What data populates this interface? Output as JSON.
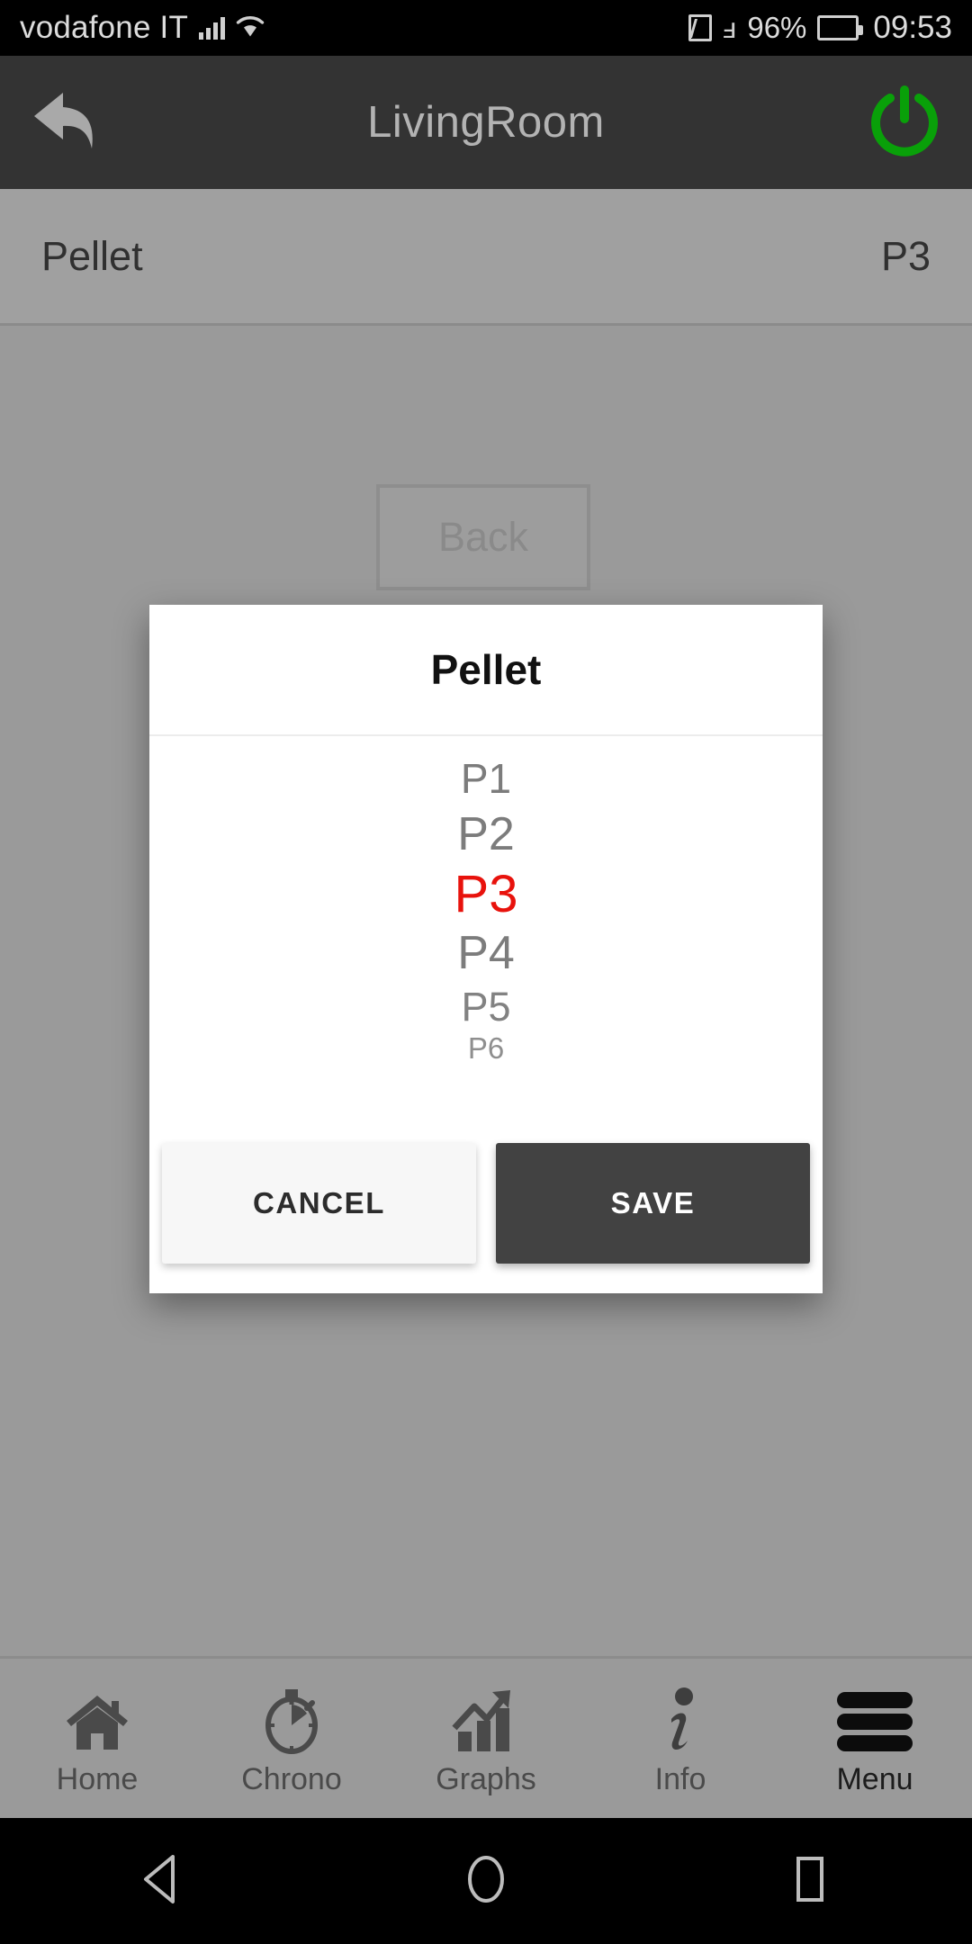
{
  "status_bar": {
    "carrier": "vodafone IT",
    "battery_percent": "96%",
    "clock": "09:53",
    "icons": [
      "signal-bars-icon",
      "wifi-icon",
      "nfc-icon",
      "bluetooth-icon",
      "battery-icon"
    ]
  },
  "app_bar": {
    "title": "LivingRoom",
    "back_icon": "back-arrow-icon",
    "power_icon": "power-icon",
    "power_color": "#00a000",
    "background": "#333333"
  },
  "content": {
    "setting_row": {
      "label": "Pellet",
      "value": "P3"
    },
    "back_button_label": "Back"
  },
  "dialog": {
    "title": "Pellet",
    "selected_value": "P3",
    "selected_color": "#e8120c",
    "option_color": "#7c7c7c",
    "options": [
      {
        "label": "P1",
        "size": 46,
        "opacity": 1.0,
        "gap": 12,
        "selected": false
      },
      {
        "label": "P2",
        "size": 52,
        "opacity": 1.0,
        "gap": 10,
        "selected": false
      },
      {
        "label": "P3",
        "size": 58,
        "opacity": 1.0,
        "gap": 10,
        "selected": true
      },
      {
        "label": "P4",
        "size": 52,
        "opacity": 1.0,
        "gap": 10,
        "selected": false
      },
      {
        "label": "P5",
        "size": 45,
        "opacity": 0.95,
        "gap": 6,
        "selected": false
      },
      {
        "label": "P6",
        "size": 33,
        "opacity": 0.85,
        "gap": 0,
        "selected": false
      }
    ],
    "cancel_label": "CANCEL",
    "save_label": "SAVE"
  },
  "tab_bar": {
    "items": [
      {
        "label": "Home",
        "icon": "home-icon",
        "active": false
      },
      {
        "label": "Chrono",
        "icon": "stopwatch-icon",
        "active": false
      },
      {
        "label": "Graphs",
        "icon": "chart-icon",
        "active": false
      },
      {
        "label": "Info",
        "icon": "info-icon",
        "active": false
      },
      {
        "label": "Menu",
        "icon": "hamburger-icon",
        "active": true
      }
    ]
  },
  "nav_bar": {
    "keys": [
      "back-triangle-icon",
      "home-circle-icon",
      "recents-square-icon"
    ]
  }
}
